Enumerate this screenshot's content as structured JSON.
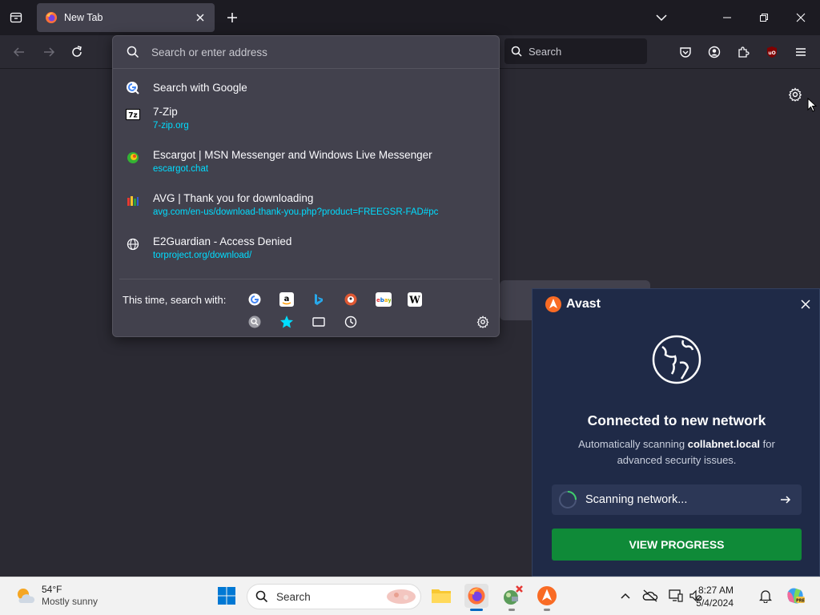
{
  "browser": {
    "tab": {
      "title": "New Tab"
    },
    "search_placeholder": "Search"
  },
  "url_dropdown": {
    "placeholder": "Search or enter address",
    "google_action": "Search with Google",
    "results": [
      {
        "title": "7-Zip",
        "url": "7-zip.org",
        "icon": "7zip-icon"
      },
      {
        "title": "Escargot | MSN Messenger and Windows Live Messenger",
        "url": "escargot.chat",
        "icon": "escargot-icon"
      },
      {
        "title": "AVG | Thank you for downloading",
        "url": "avg.com/en-us/download-thank-you.php?product=FREEGSR-FAD#pc",
        "icon": "avg-icon"
      },
      {
        "title": "E2Guardian - Access Denied",
        "url": "torproject.org/download/",
        "icon": "globe-icon"
      }
    ],
    "search_with_label": "This time, search with:",
    "engines": [
      "Google",
      "Amazon",
      "Bing",
      "DuckDuckGo",
      "eBay",
      "Wikipedia",
      "Search",
      "Bookmarks",
      "Tabs",
      "History"
    ]
  },
  "avast": {
    "brand": "Avast",
    "heading": "Connected to new network",
    "desc_prefix": "Automatically scanning",
    "network": "collabnet.local",
    "desc_suffix": "for advanced security issues.",
    "scan_text": "Scanning network...",
    "cta": "VIEW PROGRESS"
  },
  "taskbar": {
    "weather_temp": "54°F",
    "weather_cond": "Mostly sunny",
    "search_placeholder": "Search",
    "time": "8:27 AM",
    "date": "5/4/2024"
  },
  "colors": {
    "link": "#00ddff",
    "avast_bg": "#1f2a47",
    "avast_cta": "#0f8a38",
    "avast_orange": "#f96b24"
  }
}
